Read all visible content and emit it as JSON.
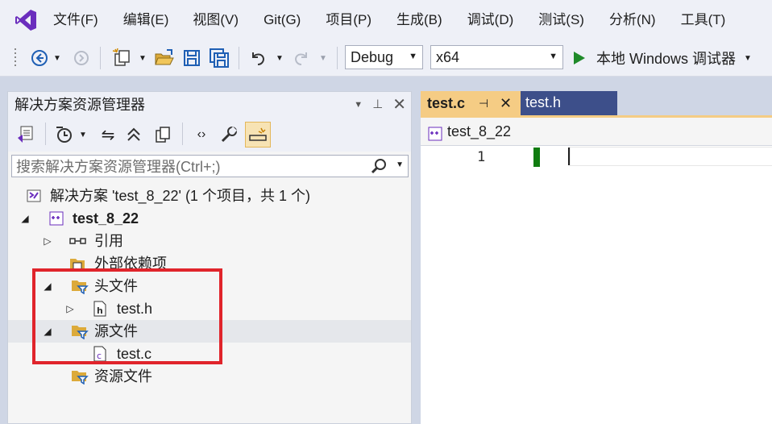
{
  "menu": {
    "items": [
      "文件(F)",
      "编辑(E)",
      "视图(V)",
      "Git(G)",
      "项目(P)",
      "生成(B)",
      "调试(D)",
      "测试(S)",
      "分析(N)",
      "工具(T)"
    ]
  },
  "toolbar": {
    "config": "Debug",
    "platform": "x64",
    "run_label": "本地 Windows 调试器"
  },
  "solution_explorer": {
    "title": "解决方案资源管理器",
    "search_placeholder": "搜索解决方案资源管理器(Ctrl+;)",
    "tree": {
      "solution": "解决方案 'test_8_22' (1 个项目，共 1 个)",
      "project": "test_8_22",
      "references": "引用",
      "external_deps": "外部依赖项",
      "header_files": "头文件",
      "test_h": "test.h",
      "source_files": "源文件",
      "test_c": "test.c",
      "resource_files": "资源文件"
    }
  },
  "editor": {
    "tabs": [
      {
        "label": "test.c",
        "active": true
      },
      {
        "label": "test.h",
        "active": false
      }
    ],
    "nav_project": "test_8_22",
    "line_numbers": [
      "1"
    ]
  },
  "colors": {
    "accent_tab": "#f5cc84",
    "inactive_tab": "#3d4f8a",
    "highlight": "#e0242b",
    "vs_purple": "#6a2dbd"
  }
}
